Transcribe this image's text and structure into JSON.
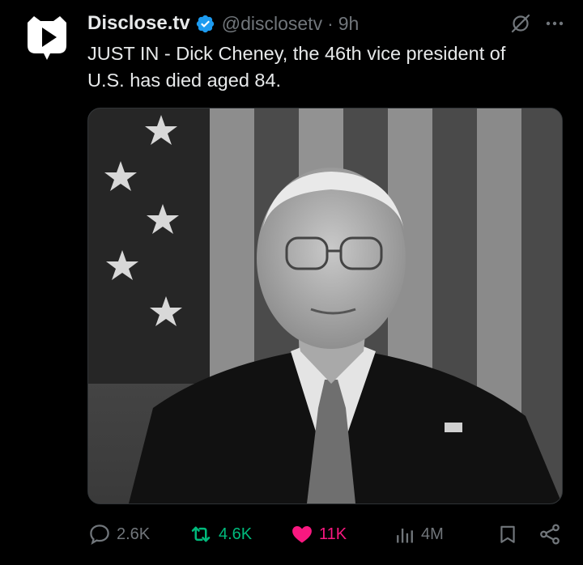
{
  "author": {
    "display_name": "Disclose.tv",
    "handle": "@disclosetv",
    "separator": "·",
    "time": "9h",
    "verified": true
  },
  "tweet": {
    "text": "JUST IN - Dick Cheney, the 46th vice president of\nU.S. has died aged 84."
  },
  "media": {
    "type": "photo",
    "description_icon": "photo-icon"
  },
  "actions": {
    "reply_count": "2.6K",
    "repost_count": "4.6K",
    "like_count": "11K",
    "view_count": "4M",
    "liked": true,
    "reposted": true
  },
  "colors": {
    "background": "#000000",
    "text": "#e7e9ea",
    "muted": "#71767b",
    "verified": "#1d9bf0",
    "repost_active": "#00ba7c",
    "like_active": "#f91880"
  }
}
